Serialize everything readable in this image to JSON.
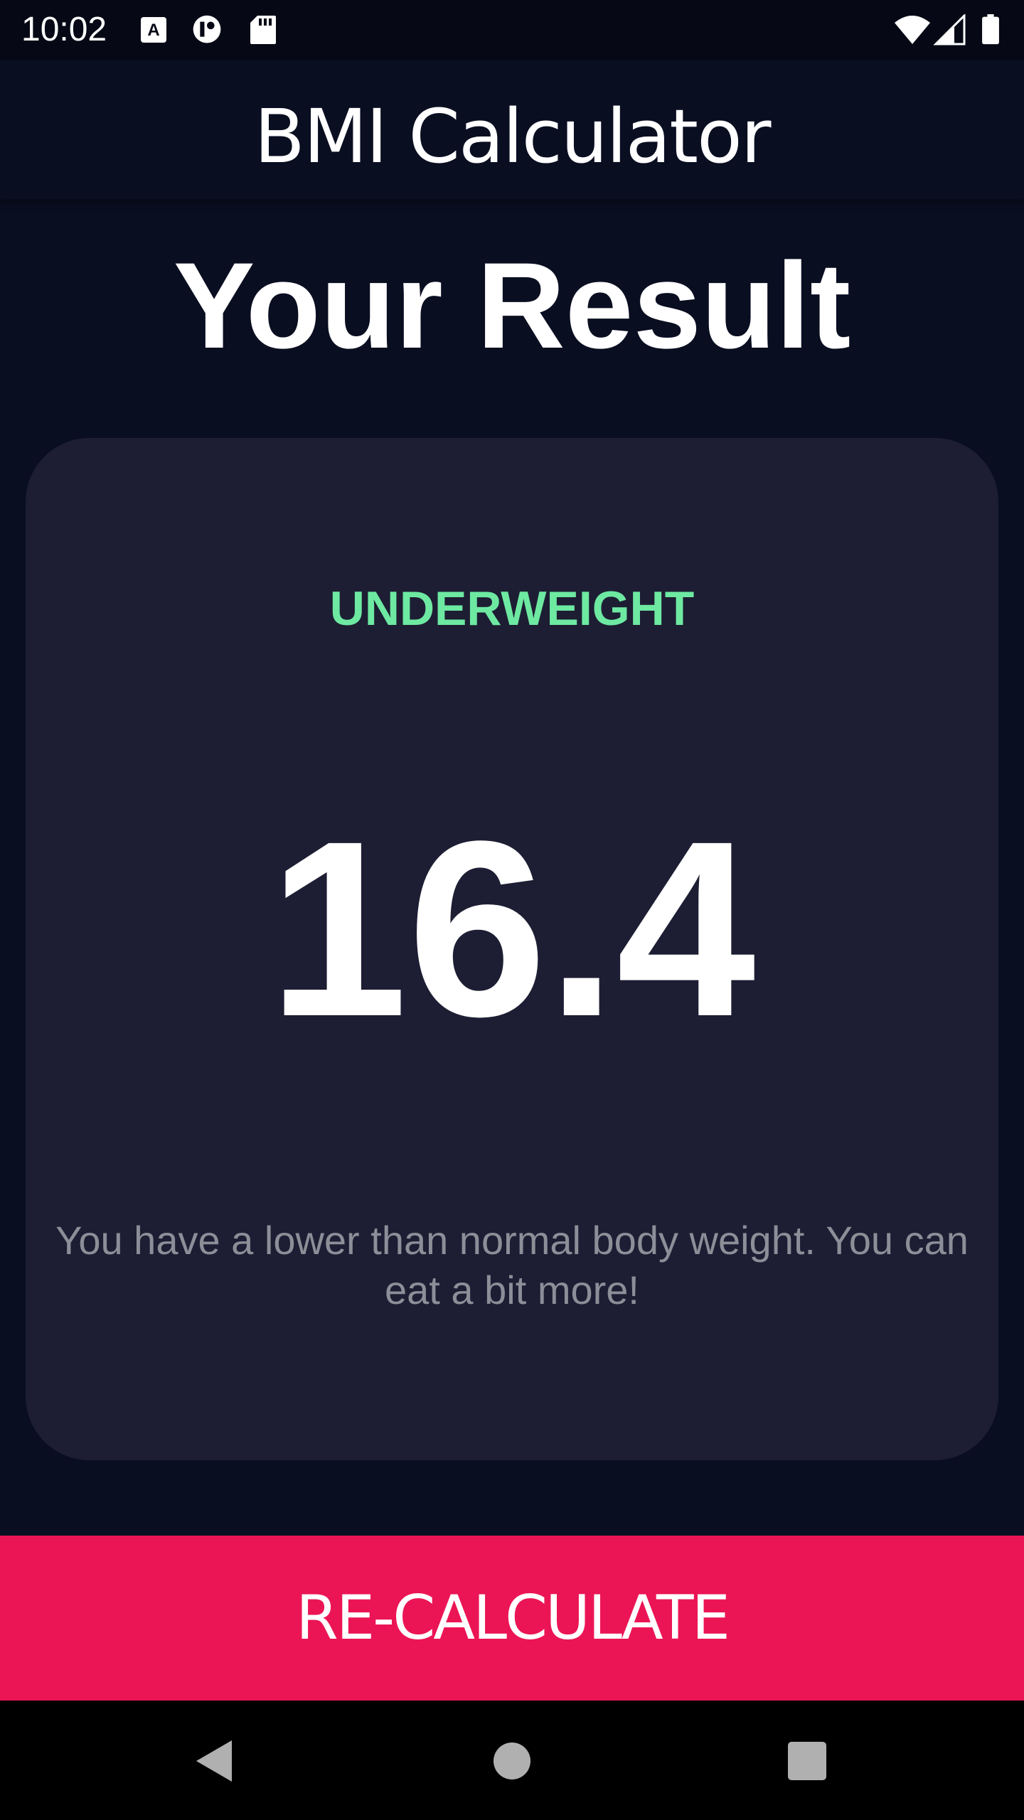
{
  "status_bar": {
    "time": "10:02",
    "icons": [
      "a-notification-icon",
      "app-notification-icon",
      "sd-card-icon",
      "wifi-icon",
      "cell-signal-icon",
      "battery-icon"
    ]
  },
  "app_bar": {
    "title": "BMI Calculator"
  },
  "result": {
    "heading": "Your Result",
    "status": "UNDERWEIGHT",
    "bmi": "16.4",
    "interpretation": "You have a lower than normal body weight. You can eat a bit more!"
  },
  "button": {
    "label": "RE-CALCULATE"
  },
  "colors": {
    "background": "#0a0e21",
    "card": "#1d1e33",
    "status_green": "#6ee9a2",
    "accent_pink": "#eb1555",
    "muted_text": "#8d8e98"
  },
  "nav_bar": {
    "icons": [
      "back-icon",
      "home-icon",
      "recents-icon"
    ]
  }
}
